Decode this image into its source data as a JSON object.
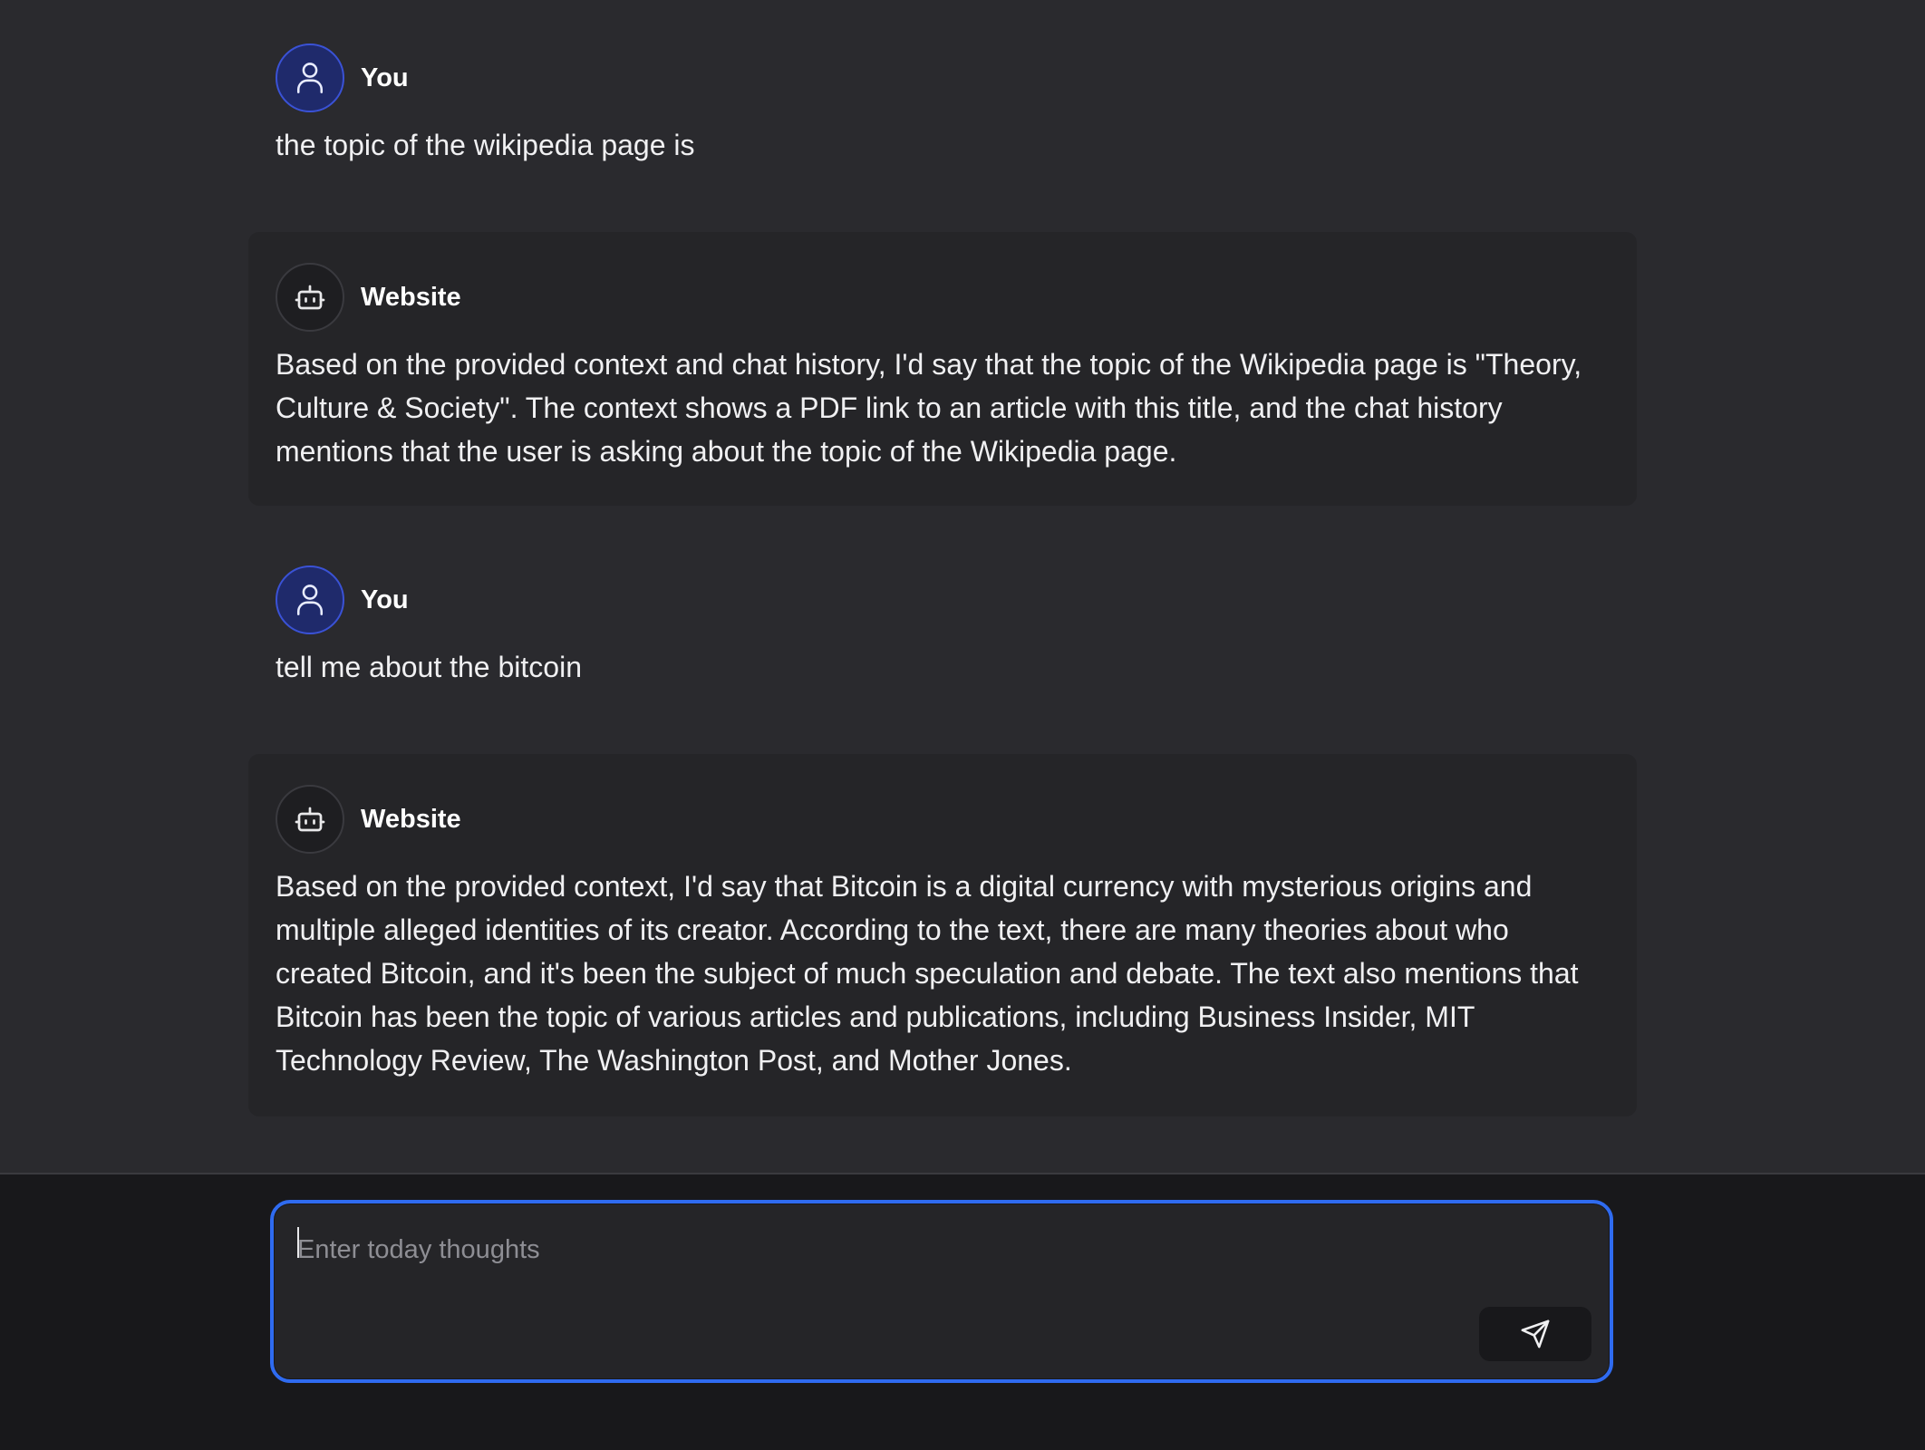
{
  "messages": [
    {
      "role": "user",
      "author": "You",
      "avatar_icon": "user-icon",
      "text": "the topic of the wikipedia page is"
    },
    {
      "role": "bot",
      "author": "Website",
      "avatar_icon": "bot-icon",
      "text": "Based on the provided context and chat history, I'd say that the topic of the Wikipedia page is \"Theory, Culture & Society\". The context shows a PDF link to an article with this title, and the chat history mentions that the user is asking about the topic of the Wikipedia page."
    },
    {
      "role": "user",
      "author": "You",
      "avatar_icon": "user-icon",
      "text": "tell me about the bitcoin"
    },
    {
      "role": "bot",
      "author": "Website",
      "avatar_icon": "bot-icon",
      "text": "Based on the provided context, I'd say that Bitcoin is a digital currency with mysterious origins and multiple alleged identities of its creator. According to the text, there are many theories about who created Bitcoin, and it's been the subject of much speculation and debate. The text also mentions that Bitcoin has been the topic of various articles and publications, including Business Insider, MIT Technology Review, The Washington Post, and Mother Jones."
    }
  ],
  "composer": {
    "placeholder": "Enter today thoughts",
    "value": "",
    "send_icon": "send-icon",
    "accent_color": "#2f6bf0"
  }
}
